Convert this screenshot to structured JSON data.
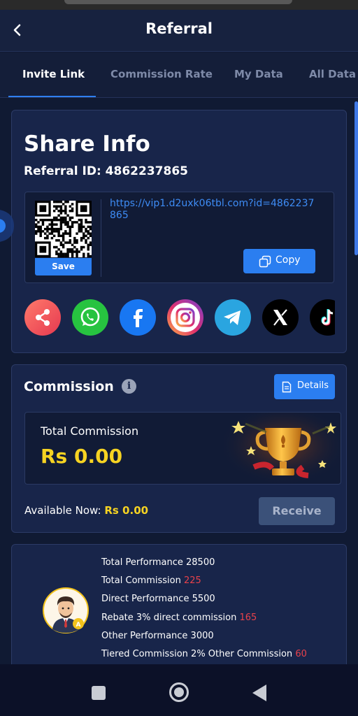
{
  "header": {
    "title": "Referral",
    "back_icon": "chevron-left-icon"
  },
  "tabs": [
    {
      "label": "Invite Link",
      "active": true
    },
    {
      "label": "Commission Rate",
      "active": false
    },
    {
      "label": "My Data",
      "active": false
    },
    {
      "label": "All Data",
      "active": false
    }
  ],
  "share": {
    "title": "Share Info",
    "referral_id": "Referral ID: 4862237865",
    "url": "https://vip1.d2uxk06tbl.com?id=4862237865",
    "save_label": "Save",
    "copy_label": "Copy",
    "socials": [
      "share-icon",
      "whatsapp-icon",
      "facebook-icon",
      "instagram-icon",
      "telegram-icon",
      "x-icon",
      "tiktok-icon"
    ]
  },
  "commission": {
    "title": "Commission",
    "details_label": "Details",
    "total_label": "Total Commission",
    "total_value": "Rs 0.00",
    "available_label": "Available Now:",
    "available_value": "Rs 0.00",
    "receive_label": "Receive"
  },
  "performance": {
    "lines": [
      {
        "label": "Total Performance 28500",
        "value": ""
      },
      {
        "label": "Total Commission",
        "value": "225"
      },
      {
        "label": "Direct Performance 5500",
        "value": ""
      },
      {
        "label": "Rebate 3% direct commission",
        "value": "165"
      },
      {
        "label": "Other Performance 3000",
        "value": ""
      },
      {
        "label": "Tiered Commission 2% Other Commission",
        "value": "60"
      }
    ]
  },
  "colors": {
    "accent": "#2b7ef0",
    "gold": "#f6d322",
    "red": "#e8424b",
    "bg": "#101a33"
  }
}
